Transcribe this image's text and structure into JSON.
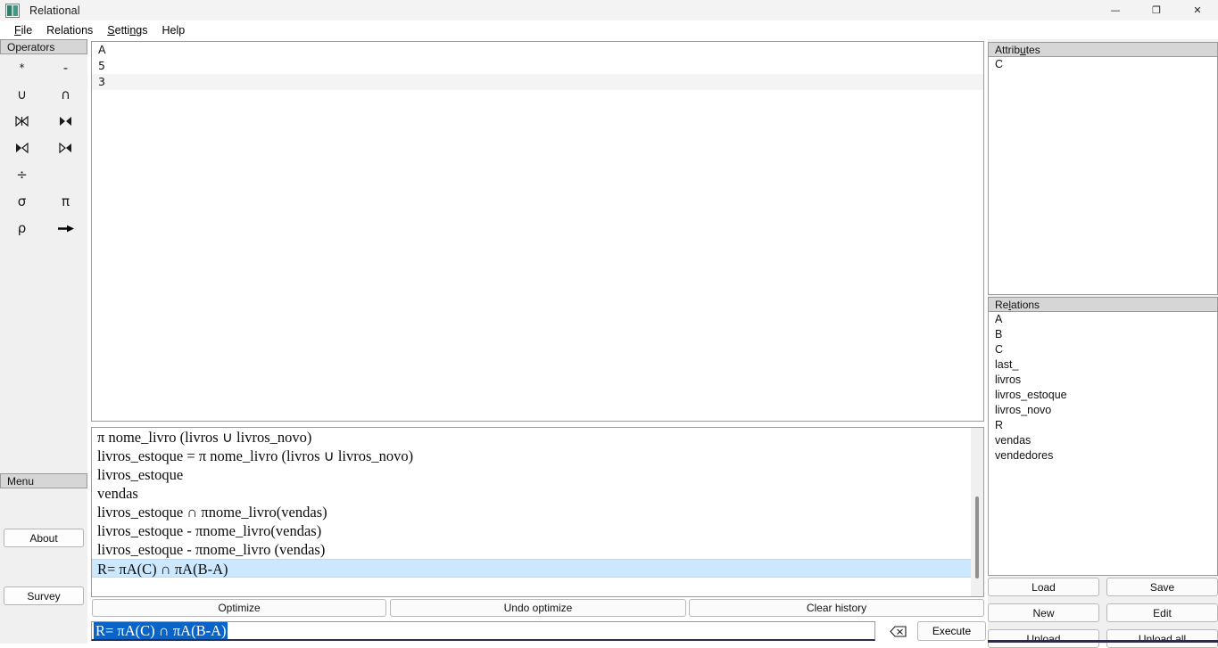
{
  "window": {
    "title": "Relational",
    "icon": "app-grid-icon",
    "controls": {
      "minimize": "—",
      "maximize": "❐",
      "close": "✕"
    }
  },
  "menubar": {
    "items": [
      {
        "label": "File",
        "mnemonic_index": 0
      },
      {
        "label": "Relations",
        "mnemonic_index": -1
      },
      {
        "label": "Settings",
        "mnemonic_index": 0
      },
      {
        "label": "Help",
        "mnemonic_index": -1
      }
    ]
  },
  "operators": {
    "header": "Operators",
    "items": [
      {
        "symbol": "*",
        "name": "product-operator"
      },
      {
        "symbol": "-",
        "name": "difference-operator"
      },
      {
        "symbol": "∪",
        "name": "union-operator"
      },
      {
        "symbol": "∩",
        "name": "intersection-operator"
      },
      {
        "symbol": "⋈",
        "name": "natural-join-operator"
      },
      {
        "symbol": "⋈",
        "name": "theta-join-operator"
      },
      {
        "symbol": "⋉",
        "name": "left-outer-join-operator"
      },
      {
        "symbol": "⋊",
        "name": "right-outer-join-operator"
      },
      {
        "symbol": "÷",
        "name": "division-operator"
      },
      {
        "symbol": "",
        "name": "empty-slot"
      },
      {
        "symbol": "σ",
        "name": "selection-operator"
      },
      {
        "symbol": "π",
        "name": "projection-operator"
      },
      {
        "symbol": "ρ",
        "name": "rename-operator"
      },
      {
        "symbol": "➡",
        "name": "arrow-operator"
      }
    ]
  },
  "side_menu": {
    "header": "Menu",
    "about_label": "About",
    "survey_label": "Survey"
  },
  "result": {
    "columns": [
      "A"
    ],
    "rows": [
      [
        "5"
      ],
      [
        "3"
      ]
    ]
  },
  "history": {
    "entries": [
      "π nome_livro (livros ∪ livros_novo)",
      "livros_estoque = π nome_livro (livros ∪ livros_novo)",
      "livros_estoque",
      "vendas",
      "livros_estoque ∩ πnome_livro(vendas)",
      "livros_estoque - πnome_livro(vendas)",
      "livros_estoque - πnome_livro (vendas)",
      "R= πA(C) ∩ πA(B-A)"
    ],
    "selected_index": 7
  },
  "actions": {
    "optimize_label": "Optimize",
    "undo_optimize_label": "Undo optimize",
    "clear_history_label": "Clear history"
  },
  "query": {
    "value": "R= πA(C) ∩ πA(B-A)",
    "selected": true,
    "clear_icon": "backspace-icon",
    "execute_label": "Execute"
  },
  "attributes": {
    "header": "Attributes",
    "mnemonic_index": 6,
    "items": [
      "C"
    ]
  },
  "relations": {
    "header": "Relations",
    "mnemonic_index": 3,
    "items": [
      "A",
      "B",
      "C",
      "last_",
      "livros",
      "livros_estoque",
      "livros_novo",
      "R",
      "vendas",
      "vendedores"
    ],
    "buttons": [
      {
        "label": "Load",
        "name": "load-button"
      },
      {
        "label": "Save",
        "name": "save-button"
      },
      {
        "label": "New",
        "name": "new-button"
      },
      {
        "label": "Edit",
        "name": "edit-button"
      },
      {
        "label": "Unload",
        "name": "unload-button"
      },
      {
        "label": "Unload all",
        "name": "unload-all-button"
      }
    ]
  },
  "colors": {
    "selection_blue": "#0a64c8",
    "row_highlight": "#cce8ff",
    "panel_header": "#d6d6d6",
    "window_bg": "#f0f0f0"
  }
}
